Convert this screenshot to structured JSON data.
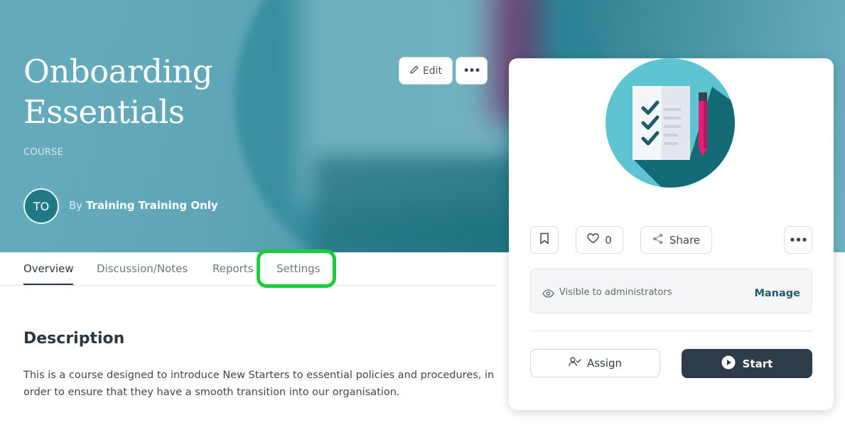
{
  "course": {
    "title_line1": "Onboarding",
    "title_line2": "Essentials",
    "type": "COURSE",
    "author_initials": "TO",
    "author_prefix": "By",
    "author_name": "Training Training Only"
  },
  "header_actions": {
    "edit_label": "Edit",
    "more_label": "•••"
  },
  "tabs": [
    {
      "label": "Overview",
      "active": true
    },
    {
      "label": "Discussion/Notes",
      "active": false
    },
    {
      "label": "Reports",
      "active": false
    },
    {
      "label": "Settings",
      "active": false
    }
  ],
  "description": {
    "heading": "Description",
    "text": "This is a course designed to introduce New Starters to essential policies and procedures, in order to ensure that they have a smooth transition into our organisation."
  },
  "card": {
    "like_count": "0",
    "share_label": "Share",
    "more_label": "•••",
    "visibility_text": "Visible to administrators",
    "manage_label": "Manage",
    "assign_label": "Assign",
    "start_label": "Start"
  },
  "colors": {
    "highlight": "#19cc3a",
    "primary_dark": "#2e3b49",
    "link": "#225b6a"
  },
  "icons": [
    "pencil-icon",
    "bookmark-icon",
    "heart-icon",
    "share-icon",
    "eye-icon",
    "assign-user-icon",
    "play-icon",
    "checklist-illustration"
  ]
}
